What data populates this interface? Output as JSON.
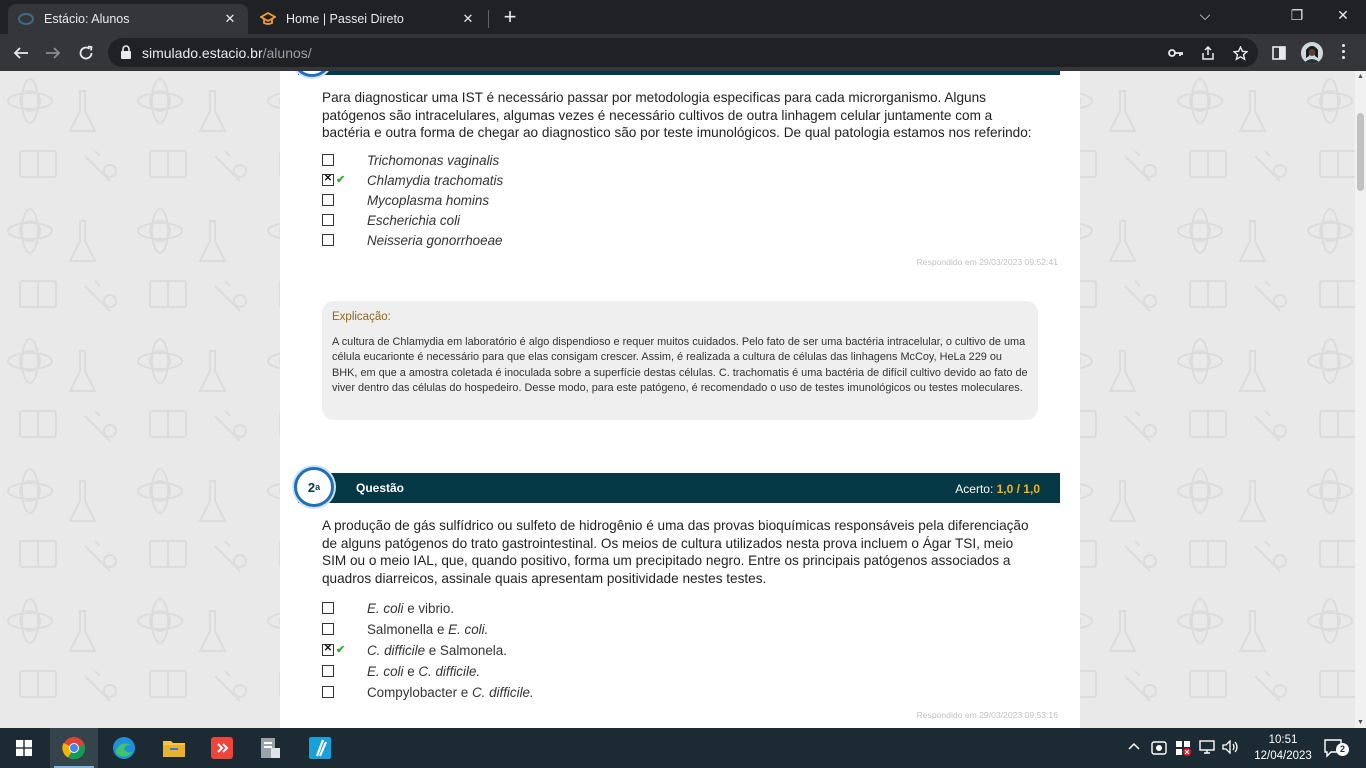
{
  "browser": {
    "tabs": [
      {
        "title": "Estácio: Alunos",
        "close": "✕"
      },
      {
        "title": "Home | Passei Direto",
        "close": "✕"
      }
    ],
    "new_tab": "+",
    "url_host": "simulado.estacio.br",
    "url_path": "/alunos/",
    "window_controls": {
      "minimize": "⌵",
      "restore": "❐",
      "close": "✕"
    }
  },
  "question1": {
    "stem": "Para diagnosticar uma IST é necessário passar por metodologia especificas para cada microrganismo. Alguns patógenos são intracelulares, algumas vezes é necessário cultivos de outra linhagem celular juntamente com a bactéria e outra forma de chegar ao diagnostico são por teste imunológicos. De qual patologia estamos nos referindo:",
    "options": [
      "Trichomonas vaginalis",
      "Chlamydia trachomatis",
      "Mycoplasma homins",
      "Escherichia coli",
      "Neisseria gonorrhoeae"
    ],
    "selected_index": 1,
    "answered": "Respondido em 29/03/2023 09:52:41",
    "explanation_title": "Explicação:",
    "explanation": "A cultura de Chlamydia em laboratório é algo dispendioso e requer muitos cuidados. Pelo fato de ser uma bactéria intracelular, o cultivo de uma célula eucarionte é necessário para que elas consigam crescer. Assim, é realizada a cultura de células das linhagens McCoy, HeLa 229 ou BHK, em que a amostra coletada é inoculada sobre a superfície destas células. C. trachomatis é uma bactéria de difícil cultivo devido ao fato de viver dentro das células do hospedeiro. Desse modo, para este patógeno, é recomendado o uso de testes imunológicos ou testes moleculares."
  },
  "question2": {
    "number": "2",
    "number_sup": "a",
    "label": "Questão",
    "score_label": "Acerto:",
    "score_value": "1,0  / 1,0",
    "stem": "A produção de gás sulfídrico ou sulfeto de hidrogênio é uma das provas bioquímicas responsáveis pela diferenciação de alguns patógenos do trato gastrointestinal. Os meios de cultura utilizados nesta prova incluem o Ágar TSI, meio SIM ou o meio IAL, que, quando positivo, forma um precipitado negro. Entre os principais patógenos associados a quadros diarreicos, assinale quais apresentam positividade nestes testes.",
    "options": [
      {
        "parts": [
          {
            "t": "E. coli",
            "i": true
          },
          {
            "t": " e vibrio.",
            "i": false
          }
        ]
      },
      {
        "parts": [
          {
            "t": "Salmonella e ",
            "i": false
          },
          {
            "t": "E. coli.",
            "i": true
          }
        ]
      },
      {
        "parts": [
          {
            "t": "C. difficile",
            "i": true
          },
          {
            "t": " e Salmonela.",
            "i": false
          }
        ]
      },
      {
        "parts": [
          {
            "t": "E. coli",
            "i": true
          },
          {
            "t": " e ",
            "i": false
          },
          {
            "t": "C. difficile.",
            "i": true
          }
        ]
      },
      {
        "parts": [
          {
            "t": "Compylobacter e ",
            "i": false
          },
          {
            "t": "C. difficile.",
            "i": true
          }
        ]
      }
    ],
    "selected_index": 2,
    "answered": "Respondido em 29/03/2023 09:53:16"
  },
  "taskbar": {
    "time": "10:51",
    "date": "12/04/2023",
    "notifications": "2"
  },
  "colors": {
    "question_bar": "#043844",
    "score_accent": "#f4b41a",
    "check_green": "#3aa832",
    "explanation_title": "#8a6a1e"
  }
}
